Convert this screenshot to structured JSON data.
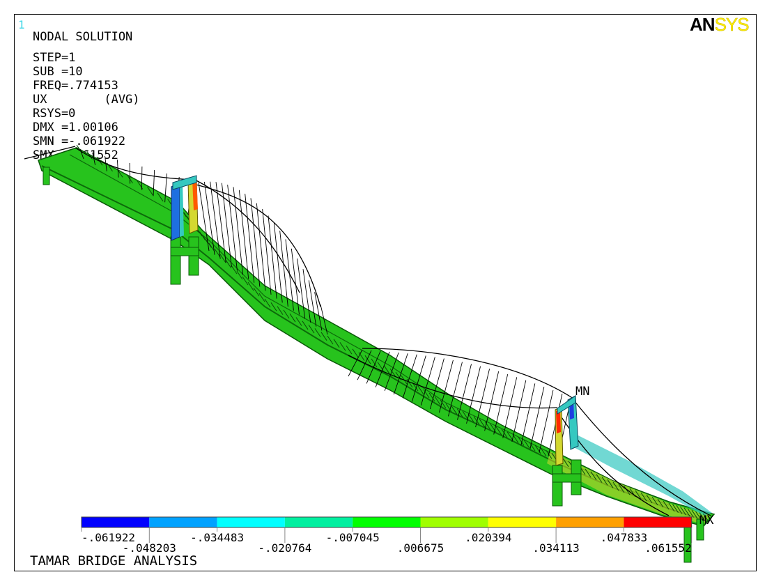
{
  "window_number": "1",
  "logo": {
    "part1": "AN",
    "part2": "SYS"
  },
  "info": {
    "title": "NODAL SOLUTION",
    "lines": [
      "STEP=1",
      "SUB =10",
      "FREQ=.774153",
      "UX        (AVG)",
      "RSYS=0",
      "DMX =1.00106",
      "SMN =-.061922",
      "SMX =.061552"
    ]
  },
  "markers": {
    "min": "MN",
    "max": "MX"
  },
  "footer_title": "TAMAR BRIDGE ANALYSIS",
  "legend": {
    "colors": [
      "#0000ff",
      "#00a2ff",
      "#00ffff",
      "#00f0a0",
      "#00ff00",
      "#a0ff00",
      "#ffff00",
      "#ffa000",
      "#ff0000"
    ],
    "labels": [
      "-.061922",
      "-.048203",
      "-.034483",
      "-.020764",
      "-.007045",
      ".006675",
      ".020394",
      ".034113",
      ".047833",
      ".061552"
    ]
  }
}
